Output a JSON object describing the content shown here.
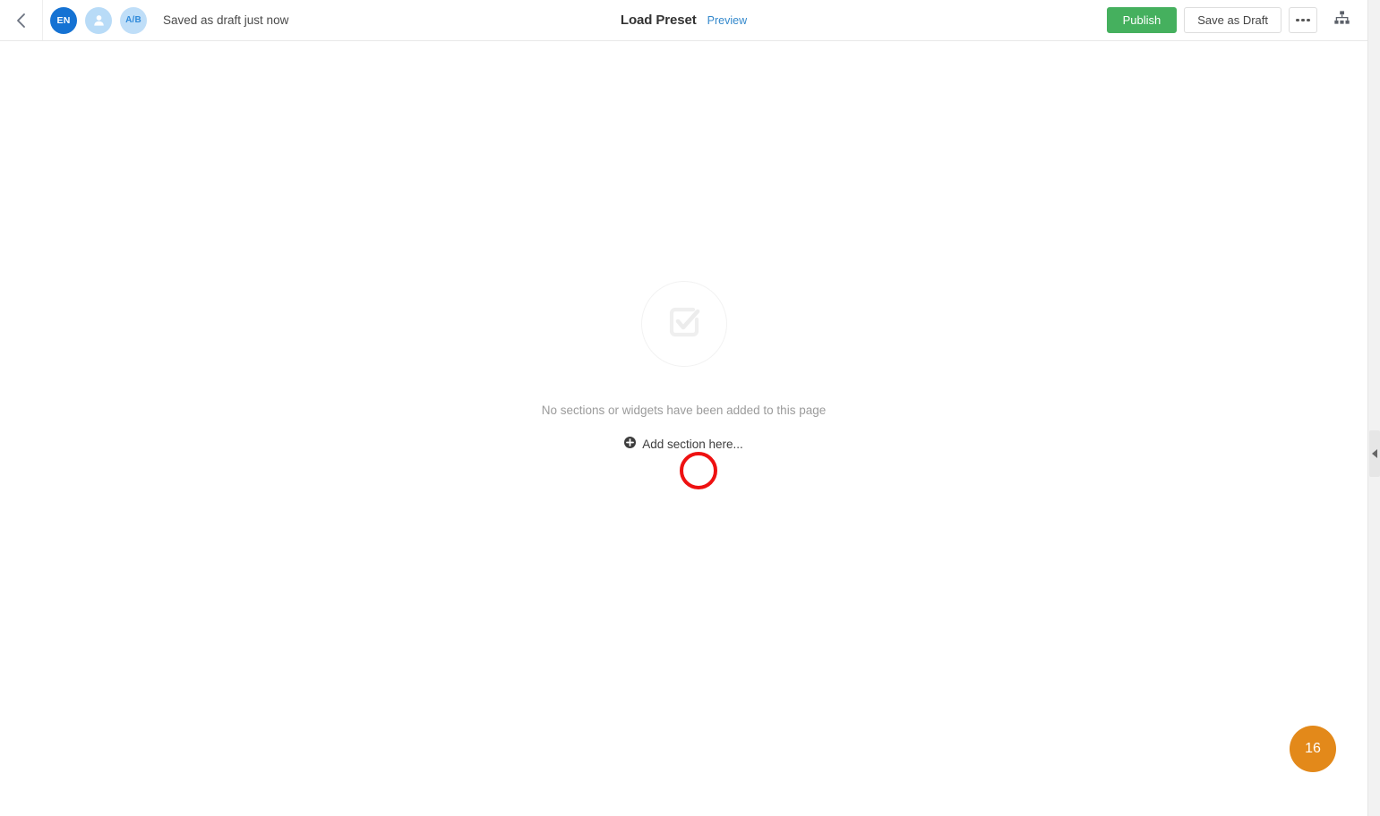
{
  "header": {
    "back_icon": "chevron-left-icon",
    "avatars": [
      {
        "name": "language-badge",
        "label": "EN",
        "kind": "text"
      },
      {
        "name": "audience-badge",
        "label": "",
        "kind": "person-icon"
      },
      {
        "name": "ab-test-badge",
        "label": "A/B",
        "kind": "text"
      }
    ],
    "saved_status": "Saved as draft just now",
    "title": "Load Preset",
    "preview_label": "Preview",
    "publish_label": "Publish",
    "save_draft_label": "Save as Draft",
    "more_icon": "ellipsis-icon",
    "sitemap_icon": "sitemap-icon",
    "colors": {
      "publish": "#45b05e",
      "preview_link": "#3388cc",
      "language_badge": "#1572d3",
      "ab_badge_bg": "#bfdef8"
    }
  },
  "canvas": {
    "empty_icon": "checkbox-checked-icon",
    "empty_message": "No sections or widgets have been added to this page",
    "add_section_label": "Add section here...",
    "add_section_icon": "plus-circle-icon"
  },
  "annotation": {
    "circle": {
      "name": "click-target-highlight",
      "color": "#ee1111"
    },
    "step_badge": {
      "label": "16",
      "color": "#e3891a"
    }
  },
  "right_rail": {
    "collapse_icon": "triangle-left-icon"
  }
}
